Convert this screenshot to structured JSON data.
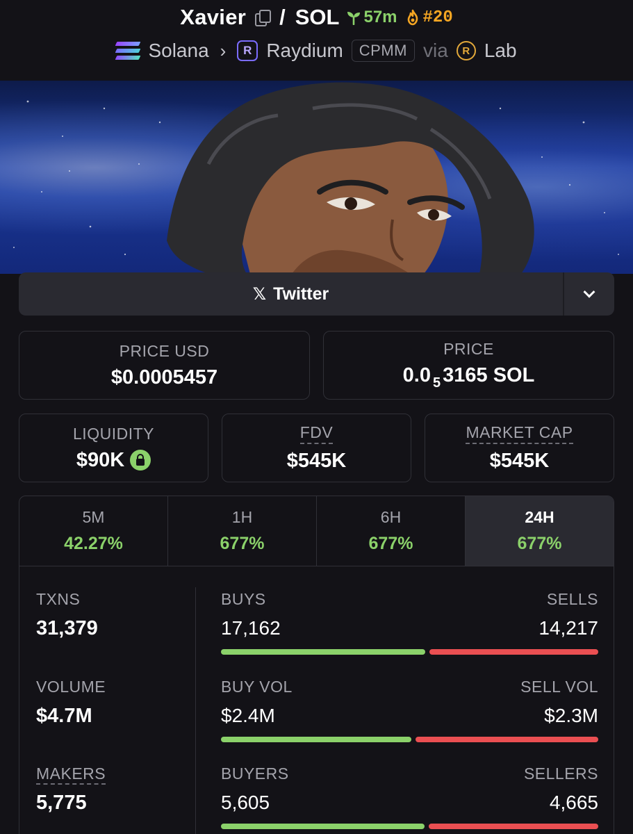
{
  "header": {
    "token_name": "Xavier",
    "separator": "/",
    "quote": "SOL",
    "age": "57m",
    "rank": "#20"
  },
  "chain": {
    "network": "Solana",
    "dex": "Raydium",
    "pool_type": "CPMM",
    "via_label": "via",
    "launchpad": "Lab"
  },
  "social": {
    "twitter_label": "Twitter"
  },
  "prices": {
    "usd_label": "PRICE USD",
    "usd_value": "$0.0005457",
    "native_label": "PRICE",
    "native_prefix": "0.0",
    "native_zeros": "5",
    "native_digits": "3165 SOL"
  },
  "metrics_top": {
    "liquidity_label": "LIQUIDITY",
    "liquidity_value": "$90K",
    "fdv_label": "FDV",
    "fdv_value": "$545K",
    "mcap_label": "MARKET CAP",
    "mcap_value": "$545K"
  },
  "timeframes": [
    {
      "label": "5M",
      "change": "42.27%"
    },
    {
      "label": "1H",
      "change": "677%"
    },
    {
      "label": "6H",
      "change": "677%"
    },
    {
      "label": "24H",
      "change": "677%"
    }
  ],
  "active_timeframe": "24H",
  "stats": {
    "txns_label": "TXNS",
    "txns_value": "31,379",
    "volume_label": "VOLUME",
    "volume_value": "$4.7M",
    "makers_label": "MAKERS",
    "makers_value": "5,775",
    "buys_label": "BUYS",
    "buys_value": "17,162",
    "buys_fraction": 0.547,
    "sells_label": "SELLS",
    "sells_value": "14,217",
    "buy_vol_label": "BUY VOL",
    "buy_vol_value": "$2.4M",
    "buy_vol_fraction": 0.51,
    "sell_vol_label": "SELL VOL",
    "sell_vol_value": "$2.3M",
    "buyers_label": "BUYERS",
    "buyers_value": "5,605",
    "buyers_fraction": 0.546,
    "sellers_label": "SELLERS",
    "sellers_value": "4,665"
  },
  "colors": {
    "positive": "#8bd16a",
    "negative": "#ea4f52",
    "rank": "#f5a623",
    "background": "#131217"
  }
}
